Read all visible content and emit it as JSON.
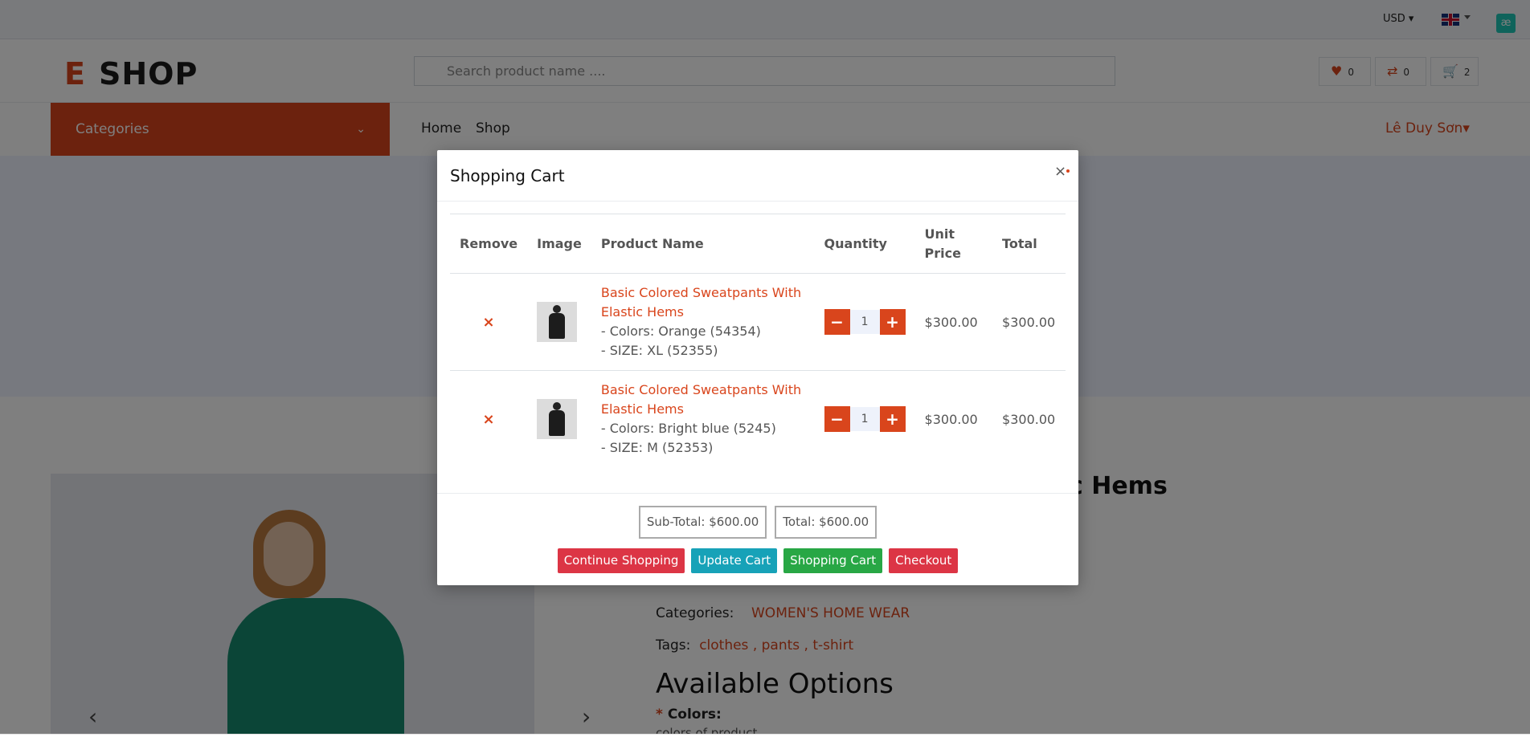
{
  "topbar": {
    "currency": "USD",
    "currency_caret": "▾",
    "language_flag": "uk-flag-icon",
    "extension_badge": "æ"
  },
  "header": {
    "logo_e": "E",
    "logo_text": "SHOP",
    "search_placeholder": "Search product name ....",
    "wishlist_icon": "heart-icon",
    "wishlist_count": "0",
    "compare_icon": "compare-icon",
    "compare_count": "0",
    "cart_icon": "cart-icon",
    "cart_count": "2"
  },
  "nav": {
    "categories_label": "Categories",
    "categories_chevron": "⌄",
    "home": "Home",
    "shop": "Shop",
    "user": "Lê Duy Sơn",
    "user_caret": "▾"
  },
  "product": {
    "title_fragment": "c Hems",
    "sku_fragment": "",
    "categories_label": "Categories:",
    "categories_value": "WOMEN'S HOME WEAR",
    "tags_label": "Tags:",
    "tags_value": "clothes , pants , t-shirt",
    "available_options": "Available Options",
    "colors_required": "*",
    "colors_label": "Colors:",
    "colors_sub": "colors of product",
    "prev_arrow": "‹",
    "next_arrow": "›"
  },
  "modal": {
    "title": "Shopping Cart",
    "close": "×",
    "columns": {
      "remove": "Remove",
      "image": "Image",
      "product_name": "Product Name",
      "quantity": "Quantity",
      "unit_price": "Unit Price",
      "total": "Total"
    },
    "items": [
      {
        "remove": "×",
        "name": "Basic Colored Sweatpants With Elastic Hems",
        "option_color": "- Colors: Orange (54354)",
        "option_size": "- SIZE: XL (52355)",
        "minus": "−",
        "qty": "1",
        "plus": "+",
        "unit_price": "$300.00",
        "total": "$300.00"
      },
      {
        "remove": "×",
        "name": "Basic Colored Sweatpants With Elastic Hems",
        "option_color": "- Colors: Bright blue (5245)",
        "option_size": "- SIZE: M (52353)",
        "minus": "−",
        "qty": "1",
        "plus": "+",
        "unit_price": "$300.00",
        "total": "$300.00"
      }
    ],
    "subtotal": "Sub-Total: $600.00",
    "total": "Total: $600.00",
    "buttons": {
      "continue": "Continue Shopping",
      "update": "Update Cart",
      "cart": "Shopping Cart",
      "checkout": "Checkout"
    }
  },
  "colors": {
    "brand": "#d9451c",
    "continue_btn": "#dc3545",
    "update_btn": "#17a2b8",
    "cart_btn": "#28a745",
    "checkout_btn": "#dc3545"
  }
}
